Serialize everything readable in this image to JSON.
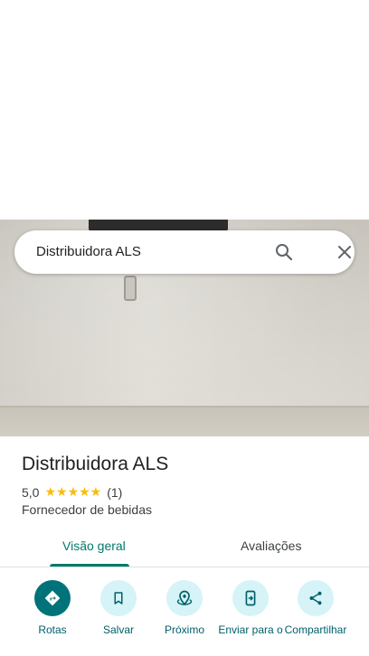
{
  "search": {
    "query": "Distribuidora ALS",
    "search_icon": "search-icon",
    "close_icon": "close-icon"
  },
  "place": {
    "name": "Distribuidora ALS",
    "rating": "5,0",
    "stars": "★★★★★",
    "rating_value": 5.0,
    "review_count": "(1)",
    "category": "Fornecedor de bebidas"
  },
  "tabs": [
    {
      "label": "Visão geral",
      "selected": true
    },
    {
      "label": "Avaliações",
      "selected": false
    }
  ],
  "actions": [
    {
      "label": "Rotas",
      "icon": "directions-icon"
    },
    {
      "label": "Salvar",
      "icon": "bookmark-icon"
    },
    {
      "label": "Próximo",
      "icon": "nearby-icon"
    },
    {
      "label": "Enviar para o",
      "icon": "send-to-phone-icon"
    },
    {
      "label": "Compartilhar",
      "icon": "share-icon"
    }
  ],
  "colors": {
    "accent": "#00796b",
    "action_primary": "#00727a",
    "action_bg": "#d6f3f7",
    "star": "#fbbc04"
  }
}
